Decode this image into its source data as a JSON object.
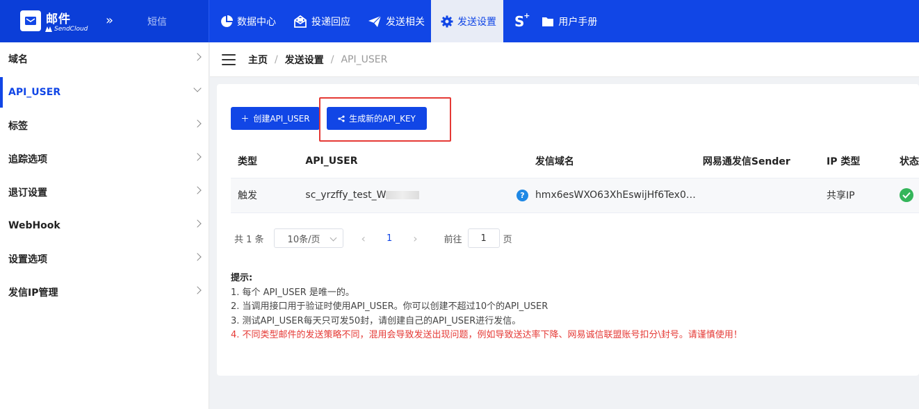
{
  "header": {
    "brand_title": "邮件",
    "brand_sub": "SendCloud",
    "sms_label": "短信",
    "nav": [
      {
        "label": "数据中心",
        "icon": "pie-chart-icon"
      },
      {
        "label": "投递回应",
        "icon": "mail-open-icon"
      },
      {
        "label": "发送相关",
        "icon": "paper-plane-icon"
      },
      {
        "label": "发送设置",
        "icon": "gear-icon",
        "active": true
      },
      {
        "label": "S",
        "icon": "s-plus-icon"
      },
      {
        "label": "用户手册",
        "icon": "folder-icon"
      }
    ]
  },
  "sidebar": {
    "items": [
      {
        "label": "域名"
      },
      {
        "label": "API_USER",
        "active": true
      },
      {
        "label": "标签"
      },
      {
        "label": "追踪选项"
      },
      {
        "label": "退订设置"
      },
      {
        "label": "WebHook"
      },
      {
        "label": "设置选项"
      },
      {
        "label": "发信IP管理"
      }
    ]
  },
  "breadcrumb": {
    "home": "主页",
    "section": "发送设置",
    "current": "API_USER",
    "sep": "/"
  },
  "toolbar": {
    "create_label": "创建API_USER",
    "generate_label": "生成新的API_KEY"
  },
  "table": {
    "headers": [
      "类型",
      "API_USER",
      "",
      "发信域名",
      "网易通发信Sender",
      "IP 类型",
      "状态"
    ],
    "rows": [
      {
        "type": "触发",
        "api_user": "sc_yrzffy_test_W",
        "domain": "hmx6esWXO63XhEswijHf6Tex0…",
        "sender": "",
        "ip_type": "共享IP"
      }
    ]
  },
  "pagination": {
    "total": "共 1 条",
    "page_size": "10条/页",
    "current_page": "1",
    "goto_label": "前往",
    "goto_value": "1",
    "page_suffix": "页"
  },
  "tips": {
    "title": "提示:",
    "lines": [
      "1. 每个 API_USER 是唯一的。",
      "2. 当调用接口用于验证时使用API_USER。你可以创建不超过10个的API_USER",
      "3. 测试API_USER每天只可发50封，请创建自己的API_USER进行发信。"
    ],
    "warning": "4. 不同类型邮件的发送策略不同，混用会导致发送出现问题，例如导致送达率下降、网易诚信联盟账号扣分\\封号。请谨慎使用！"
  },
  "colors": {
    "primary": "#1146e6",
    "warning": "#e53935",
    "success": "#34b55a"
  }
}
